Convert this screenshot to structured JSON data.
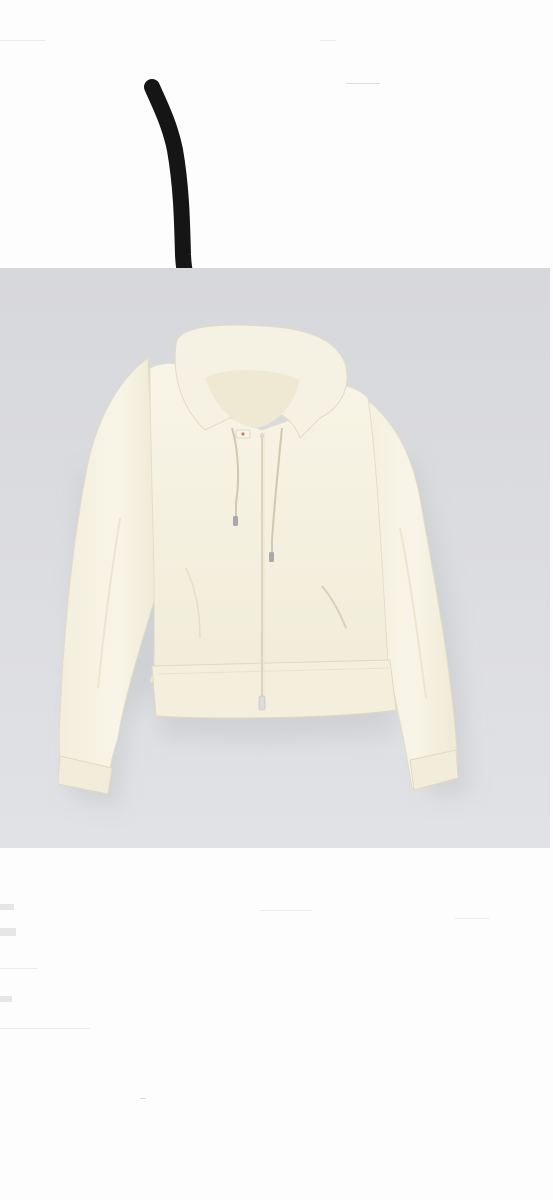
{
  "image": {
    "subject": "hoodie-photo",
    "colors": {
      "page_background": "#fdfdfd",
      "photo_background": "#dcdde1",
      "garment": "#f5f1e2",
      "garment_shadow": "#e6e0cb",
      "marker": "#151515"
    }
  }
}
